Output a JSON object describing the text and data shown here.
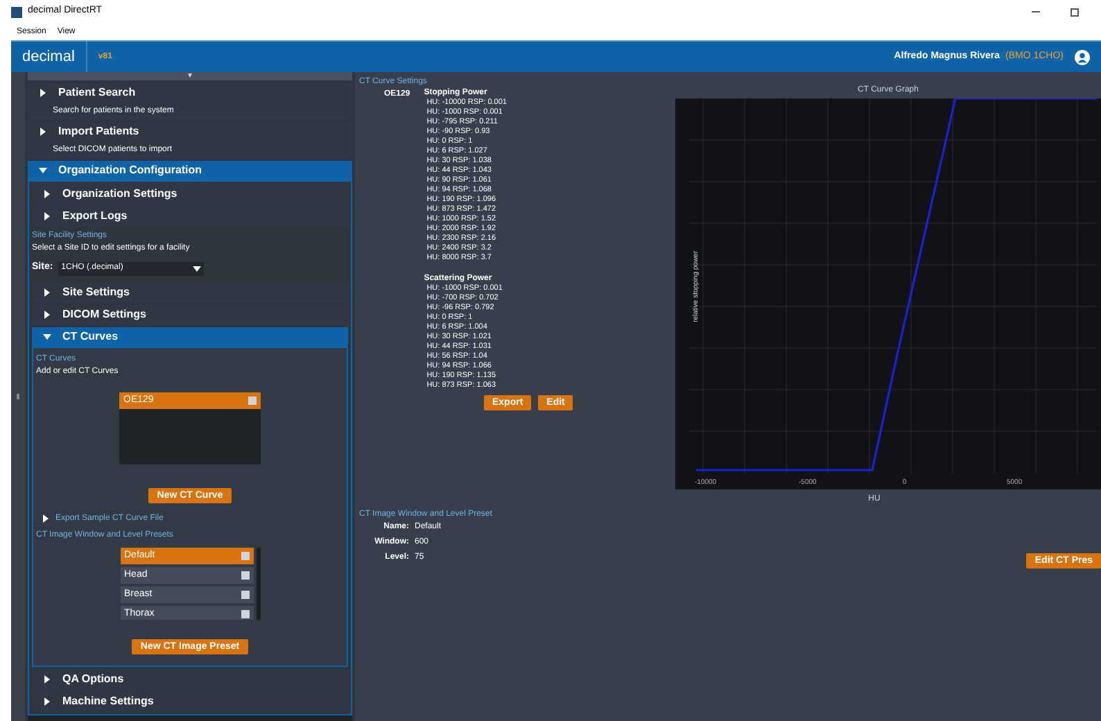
{
  "window": {
    "title": "decimal DirectRT"
  },
  "menu": [
    "Session",
    "View"
  ],
  "header": {
    "logo": "decimal",
    "version": "v81",
    "user": "Alfredo Magnus Rivera",
    "site": "(BMO 1CHO)"
  },
  "sidebar": {
    "collapse_glyph": "▾",
    "sections": [
      {
        "title": "Patient Search",
        "description": "Search for patients in the system",
        "expanded": false
      },
      {
        "title": "Import Patients",
        "description": "Select DICOM patients to import",
        "expanded": false
      },
      {
        "title": "Organization Configuration",
        "expanded": true
      }
    ],
    "org_sections": [
      {
        "title": "Organization Settings",
        "expanded": false
      },
      {
        "title": "Export Logs",
        "expanded": false
      }
    ],
    "site_facility": {
      "heading": "Site Facility Settings",
      "description": "Select a Site ID to edit settings for a facility",
      "label": "Site:",
      "value": "1CHO (.decimal)"
    },
    "site_sections": [
      {
        "title": "Site Settings",
        "expanded": false
      },
      {
        "title": "DICOM Settings",
        "expanded": false
      },
      {
        "title": "CT Curves",
        "expanded": true
      }
    ],
    "ct_curves": {
      "heading": "CT Curves",
      "description": "Add or edit CT Curves",
      "items": [
        {
          "label": "OE129",
          "selected": true
        }
      ],
      "new_button": "New CT Curve",
      "export_link": "Export Sample CT Curve File",
      "presets_heading": "CT Image Window and Level Presets",
      "presets": [
        {
          "label": "Default",
          "selected": true
        },
        {
          "label": "Head",
          "selected": false
        },
        {
          "label": "Breast",
          "selected": false
        },
        {
          "label": "Thorax",
          "selected": false
        }
      ],
      "new_preset_button": "New CT Image Preset"
    },
    "bottom_sections": [
      {
        "title": "QA Options",
        "expanded": false
      },
      {
        "title": "Machine Settings",
        "expanded": false
      }
    ]
  },
  "curve_settings": {
    "heading": "CT Curve Settings",
    "curve_name": "OE129",
    "groups": [
      {
        "title": "Stopping Power",
        "points": [
          "HU: -10000 RSP: 0.001",
          "HU: -1000 RSP: 0.001",
          "HU: -795 RSP: 0.211",
          "HU: -90 RSP: 0.93",
          "HU: 0 RSP: 1",
          "HU: 6 RSP: 1.027",
          "HU: 30 RSP: 1.038",
          "HU: 44 RSP: 1.043",
          "HU: 90 RSP: 1.061",
          "HU: 94 RSP: 1.068",
          "HU: 190 RSP: 1.096",
          "HU: 873 RSP: 1.472",
          "HU: 1000 RSP: 1.52",
          "HU: 2000 RSP: 1.92",
          "HU: 2300 RSP: 2.16",
          "HU: 2400 RSP: 3.2",
          "HU: 8000 RSP: 3.7"
        ]
      },
      {
        "title": "Scattering Power",
        "points": [
          "HU: -1000 RSP: 0.001",
          "HU: -700 RSP: 0.702",
          "HU: -96 RSP: 0.792",
          "HU: 0 RSP: 1",
          "HU: 6 RSP: 1.004",
          "HU: 30 RSP: 1.021",
          "HU: 44 RSP: 1.031",
          "HU: 56 RSP: 1.04",
          "HU: 94 RSP: 1.066",
          "HU: 190 RSP: 1.135",
          "HU: 873 RSP: 1.063"
        ]
      }
    ],
    "buttons": [
      "Export",
      "Edit"
    ]
  },
  "graph": {
    "title": "CT Curve Graph",
    "ylabel": "relative stopping power",
    "xlabel": "HU",
    "x_tick_labels": [
      "-10000",
      "-5000",
      "0",
      "5000"
    ]
  },
  "preset_details": {
    "heading": "CT Image Window and Level Preset",
    "fields": [
      {
        "label": "Name:",
        "value": "Default"
      },
      {
        "label": "Window:",
        "value": "600"
      },
      {
        "label": "Level:",
        "value": "75"
      }
    ],
    "button": "Edit CT Pres"
  }
}
